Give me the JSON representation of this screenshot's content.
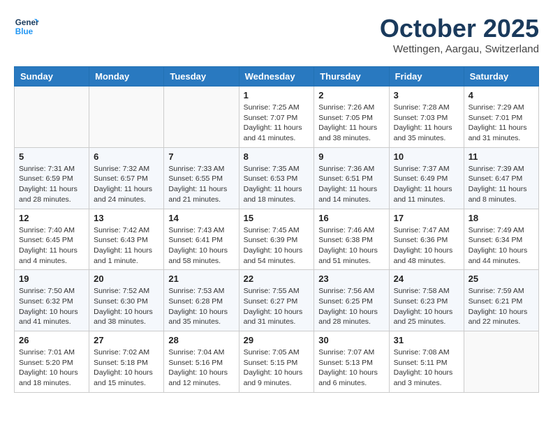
{
  "header": {
    "logo_line1": "General",
    "logo_line2": "Blue",
    "month": "October 2025",
    "location": "Wettingen, Aargau, Switzerland"
  },
  "weekdays": [
    "Sunday",
    "Monday",
    "Tuesday",
    "Wednesday",
    "Thursday",
    "Friday",
    "Saturday"
  ],
  "weeks": [
    [
      {
        "day": "",
        "text": ""
      },
      {
        "day": "",
        "text": ""
      },
      {
        "day": "",
        "text": ""
      },
      {
        "day": "1",
        "text": "Sunrise: 7:25 AM\nSunset: 7:07 PM\nDaylight: 11 hours\nand 41 minutes."
      },
      {
        "day": "2",
        "text": "Sunrise: 7:26 AM\nSunset: 7:05 PM\nDaylight: 11 hours\nand 38 minutes."
      },
      {
        "day": "3",
        "text": "Sunrise: 7:28 AM\nSunset: 7:03 PM\nDaylight: 11 hours\nand 35 minutes."
      },
      {
        "day": "4",
        "text": "Sunrise: 7:29 AM\nSunset: 7:01 PM\nDaylight: 11 hours\nand 31 minutes."
      }
    ],
    [
      {
        "day": "5",
        "text": "Sunrise: 7:31 AM\nSunset: 6:59 PM\nDaylight: 11 hours\nand 28 minutes."
      },
      {
        "day": "6",
        "text": "Sunrise: 7:32 AM\nSunset: 6:57 PM\nDaylight: 11 hours\nand 24 minutes."
      },
      {
        "day": "7",
        "text": "Sunrise: 7:33 AM\nSunset: 6:55 PM\nDaylight: 11 hours\nand 21 minutes."
      },
      {
        "day": "8",
        "text": "Sunrise: 7:35 AM\nSunset: 6:53 PM\nDaylight: 11 hours\nand 18 minutes."
      },
      {
        "day": "9",
        "text": "Sunrise: 7:36 AM\nSunset: 6:51 PM\nDaylight: 11 hours\nand 14 minutes."
      },
      {
        "day": "10",
        "text": "Sunrise: 7:37 AM\nSunset: 6:49 PM\nDaylight: 11 hours\nand 11 minutes."
      },
      {
        "day": "11",
        "text": "Sunrise: 7:39 AM\nSunset: 6:47 PM\nDaylight: 11 hours\nand 8 minutes."
      }
    ],
    [
      {
        "day": "12",
        "text": "Sunrise: 7:40 AM\nSunset: 6:45 PM\nDaylight: 11 hours\nand 4 minutes."
      },
      {
        "day": "13",
        "text": "Sunrise: 7:42 AM\nSunset: 6:43 PM\nDaylight: 11 hours\nand 1 minute."
      },
      {
        "day": "14",
        "text": "Sunrise: 7:43 AM\nSunset: 6:41 PM\nDaylight: 10 hours\nand 58 minutes."
      },
      {
        "day": "15",
        "text": "Sunrise: 7:45 AM\nSunset: 6:39 PM\nDaylight: 10 hours\nand 54 minutes."
      },
      {
        "day": "16",
        "text": "Sunrise: 7:46 AM\nSunset: 6:38 PM\nDaylight: 10 hours\nand 51 minutes."
      },
      {
        "day": "17",
        "text": "Sunrise: 7:47 AM\nSunset: 6:36 PM\nDaylight: 10 hours\nand 48 minutes."
      },
      {
        "day": "18",
        "text": "Sunrise: 7:49 AM\nSunset: 6:34 PM\nDaylight: 10 hours\nand 44 minutes."
      }
    ],
    [
      {
        "day": "19",
        "text": "Sunrise: 7:50 AM\nSunset: 6:32 PM\nDaylight: 10 hours\nand 41 minutes."
      },
      {
        "day": "20",
        "text": "Sunrise: 7:52 AM\nSunset: 6:30 PM\nDaylight: 10 hours\nand 38 minutes."
      },
      {
        "day": "21",
        "text": "Sunrise: 7:53 AM\nSunset: 6:28 PM\nDaylight: 10 hours\nand 35 minutes."
      },
      {
        "day": "22",
        "text": "Sunrise: 7:55 AM\nSunset: 6:27 PM\nDaylight: 10 hours\nand 31 minutes."
      },
      {
        "day": "23",
        "text": "Sunrise: 7:56 AM\nSunset: 6:25 PM\nDaylight: 10 hours\nand 28 minutes."
      },
      {
        "day": "24",
        "text": "Sunrise: 7:58 AM\nSunset: 6:23 PM\nDaylight: 10 hours\nand 25 minutes."
      },
      {
        "day": "25",
        "text": "Sunrise: 7:59 AM\nSunset: 6:21 PM\nDaylight: 10 hours\nand 22 minutes."
      }
    ],
    [
      {
        "day": "26",
        "text": "Sunrise: 7:01 AM\nSunset: 5:20 PM\nDaylight: 10 hours\nand 18 minutes."
      },
      {
        "day": "27",
        "text": "Sunrise: 7:02 AM\nSunset: 5:18 PM\nDaylight: 10 hours\nand 15 minutes."
      },
      {
        "day": "28",
        "text": "Sunrise: 7:04 AM\nSunset: 5:16 PM\nDaylight: 10 hours\nand 12 minutes."
      },
      {
        "day": "29",
        "text": "Sunrise: 7:05 AM\nSunset: 5:15 PM\nDaylight: 10 hours\nand 9 minutes."
      },
      {
        "day": "30",
        "text": "Sunrise: 7:07 AM\nSunset: 5:13 PM\nDaylight: 10 hours\nand 6 minutes."
      },
      {
        "day": "31",
        "text": "Sunrise: 7:08 AM\nSunset: 5:11 PM\nDaylight: 10 hours\nand 3 minutes."
      },
      {
        "day": "",
        "text": ""
      }
    ]
  ]
}
